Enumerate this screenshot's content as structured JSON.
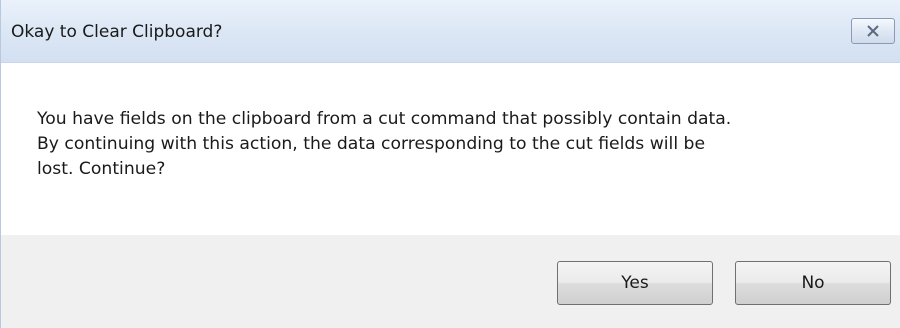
{
  "window": {
    "title": "Okay to Clear Clipboard?",
    "close_icon": "close-icon"
  },
  "message": {
    "line1": "You have fields on the clipboard from a cut command that possibly contain data.",
    "line2": "By continuing with this action, the data corresponding to the cut fields will be",
    "line3": "lost. Continue?"
  },
  "buttons": {
    "yes_label": "Yes",
    "no_label": "No"
  },
  "colors": {
    "titlebar": "#dce7f5",
    "footer": "#f0f0f0",
    "button_border": "#707070"
  }
}
